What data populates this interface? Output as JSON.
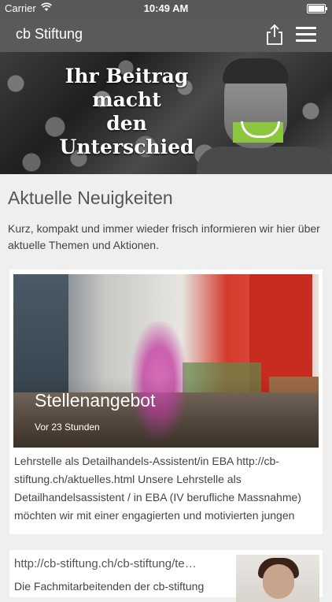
{
  "status_bar": {
    "carrier": "Carrier",
    "time": "10:49 AM"
  },
  "nav": {
    "title": "cb Stiftung",
    "share_icon": "share-icon",
    "menu_icon": "hamburger-menu-icon"
  },
  "hero": {
    "headline_line1": "Ihr Beitrag macht",
    "headline_line2": "den Unterschied",
    "accent_color": "#8cc63f"
  },
  "news": {
    "title": "Aktuelle Neuigkeiten",
    "intro": "Kurz, kompakt und immer wieder frisch informieren wir hier über aktuelle Themen und Aktionen.",
    "items": [
      {
        "title": "Stellenangebot",
        "time": "Vor 23 Stunden",
        "body": "Lehrstelle als Detailhandels-Assistent/in EBA http://cb-stiftung.ch/aktuelles.html Unsere Lehrstelle als Detailhandelsassistent / in EBA (IV berufliche Massnahme) möchten wir mit einer engagierten und motivierten jungen"
      },
      {
        "link": "http://cb-stiftung.ch/cb-stiftung/te…",
        "snippet": "Die Fachmitarbeitenden der cb-stiftung"
      }
    ]
  }
}
